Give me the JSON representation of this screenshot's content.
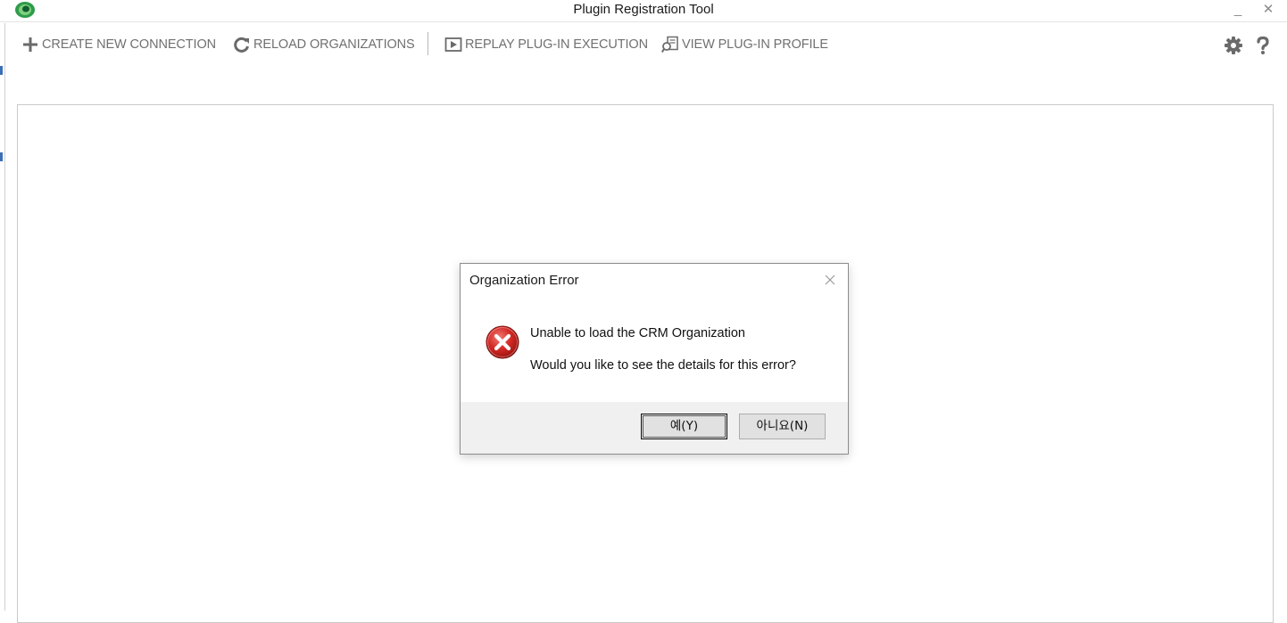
{
  "window": {
    "title": "Plugin Registration Tool",
    "minimize_glyph": "_",
    "close_glyph": "✕"
  },
  "toolbar": {
    "create_connection": {
      "label": "CREATE NEW CONNECTION",
      "icon": "plus-icon"
    },
    "reload_organizations": {
      "label": "RELOAD ORGANIZATIONS",
      "icon": "refresh-icon"
    },
    "replay_execution": {
      "label": "REPLAY PLUG-IN EXECUTION",
      "icon": "play-icon"
    },
    "view_profile": {
      "label": "VIEW PLUG-IN PROFILE",
      "icon": "profile-search-icon"
    },
    "settings": {
      "icon": "gear-icon"
    },
    "help": {
      "icon": "question-icon"
    }
  },
  "dialog": {
    "title": "Organization Error",
    "message_line1": "Unable to load the CRM Organization",
    "message_line2": "Would you like to see the details for this error?",
    "icon": "error-icon",
    "yes_label": "예(Y)",
    "no_label": "아니요(N)"
  },
  "colors": {
    "toolbar_text": "#707070",
    "error_red": "#c8191c",
    "dialog_footer": "#f0f0f0",
    "logo_green": "#2e9c4a"
  }
}
